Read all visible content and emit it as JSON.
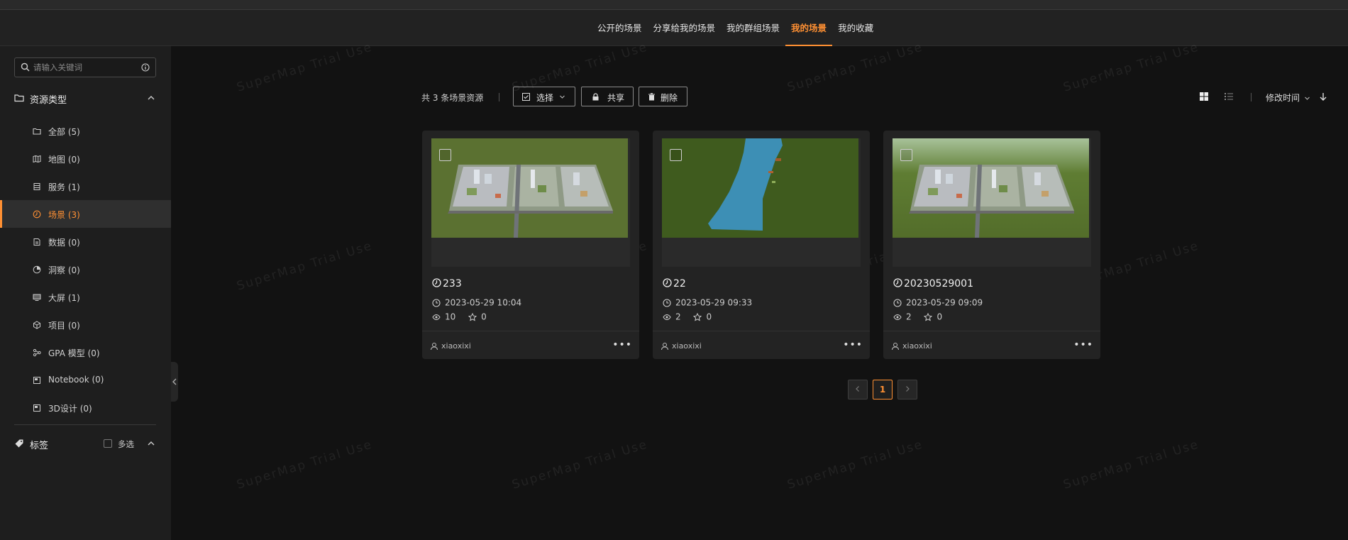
{
  "nav": {
    "tabs": [
      {
        "label": "公开的场景",
        "active": false
      },
      {
        "label": "分享给我的场景",
        "active": false
      },
      {
        "label": "我的群组场景",
        "active": false
      },
      {
        "label": "我的场景",
        "active": true
      },
      {
        "label": "我的收藏",
        "active": false
      }
    ]
  },
  "sidebar": {
    "search_placeholder": "请输入关键词",
    "resource_type_title": "资源类型",
    "items": [
      {
        "label": "全部 (5)",
        "icon": "folder-icon",
        "active": false
      },
      {
        "label": "地图 (0)",
        "icon": "map-icon",
        "active": false
      },
      {
        "label": "服务 (1)",
        "icon": "server-icon",
        "active": false
      },
      {
        "label": "场景 (3)",
        "icon": "scene-icon",
        "active": true
      },
      {
        "label": "数据 (0)",
        "icon": "data-icon",
        "active": false
      },
      {
        "label": "洞察 (0)",
        "icon": "insight-icon",
        "active": false
      },
      {
        "label": "大屏 (1)",
        "icon": "screen-icon",
        "active": false
      },
      {
        "label": "项目 (0)",
        "icon": "cube-icon",
        "active": false
      },
      {
        "label": "GPA 模型 (0)",
        "icon": "model-icon",
        "active": false
      },
      {
        "label": "Notebook (0)",
        "icon": "notebook-icon",
        "active": false
      },
      {
        "label": "3D设计 (0)",
        "icon": "design-icon",
        "active": false
      }
    ],
    "tags_title": "标签",
    "multi_select_label": "多选"
  },
  "watermark": "SuperMap Trial Use",
  "toolbar": {
    "count_text": "共 3 条场景资源",
    "select_label": "选择",
    "share_label": "共享",
    "delete_label": "删除",
    "sort_label": "修改时间"
  },
  "cards": [
    {
      "title": "233",
      "date": "2023-05-29 10:04",
      "views": "10",
      "stars": "0",
      "user": "xiaoxixi",
      "thumb": "city"
    },
    {
      "title": "22",
      "date": "2023-05-29 09:33",
      "views": "2",
      "stars": "0",
      "user": "xiaoxixi",
      "thumb": "river"
    },
    {
      "title": "20230529001",
      "date": "2023-05-29 09:09",
      "views": "2",
      "stars": "0",
      "user": "xiaoxixi",
      "thumb": "city"
    }
  ],
  "pagination": {
    "current": "1"
  },
  "colors": {
    "accent": "#ff9033",
    "background": "#121212",
    "sidebar": "#1e1e1e",
    "card": "#232323"
  }
}
